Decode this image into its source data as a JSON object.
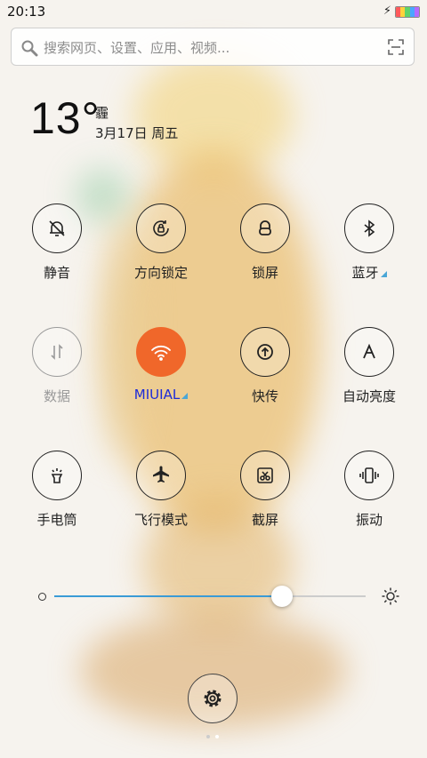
{
  "status": {
    "time": "20:13"
  },
  "search": {
    "placeholder": "搜索网页、设置、应用、视频..."
  },
  "weather": {
    "temp": "13°",
    "condition": "霾",
    "date": "3月17日 周五"
  },
  "toggles": [
    {
      "label": "静音",
      "icon": "bell-off-icon",
      "state": "on"
    },
    {
      "label": "方向锁定",
      "icon": "rotation-lock-icon",
      "state": "on"
    },
    {
      "label": "锁屏",
      "icon": "lock-icon",
      "state": "on"
    },
    {
      "label": "蓝牙",
      "icon": "bluetooth-icon",
      "state": "on",
      "expandable": true
    },
    {
      "label": "数据",
      "icon": "mobile-data-icon",
      "state": "disabled"
    },
    {
      "label": "MIUIAL",
      "icon": "wifi-icon",
      "state": "active",
      "expandable": true
    },
    {
      "label": "快传",
      "icon": "quick-transfer-icon",
      "state": "on"
    },
    {
      "label": "自动亮度",
      "icon": "auto-brightness-icon",
      "state": "on"
    },
    {
      "label": "手电筒",
      "icon": "flashlight-icon",
      "state": "on"
    },
    {
      "label": "飞行模式",
      "icon": "airplane-icon",
      "state": "on"
    },
    {
      "label": "截屏",
      "icon": "screenshot-icon",
      "state": "on"
    },
    {
      "label": "振动",
      "icon": "vibrate-icon",
      "state": "on"
    }
  ],
  "brightness": {
    "value": 0.73
  },
  "colors": {
    "accent": "#f0672a",
    "slider_fill": "#3a9bd6",
    "wifi_label": "#1c2bd8"
  }
}
